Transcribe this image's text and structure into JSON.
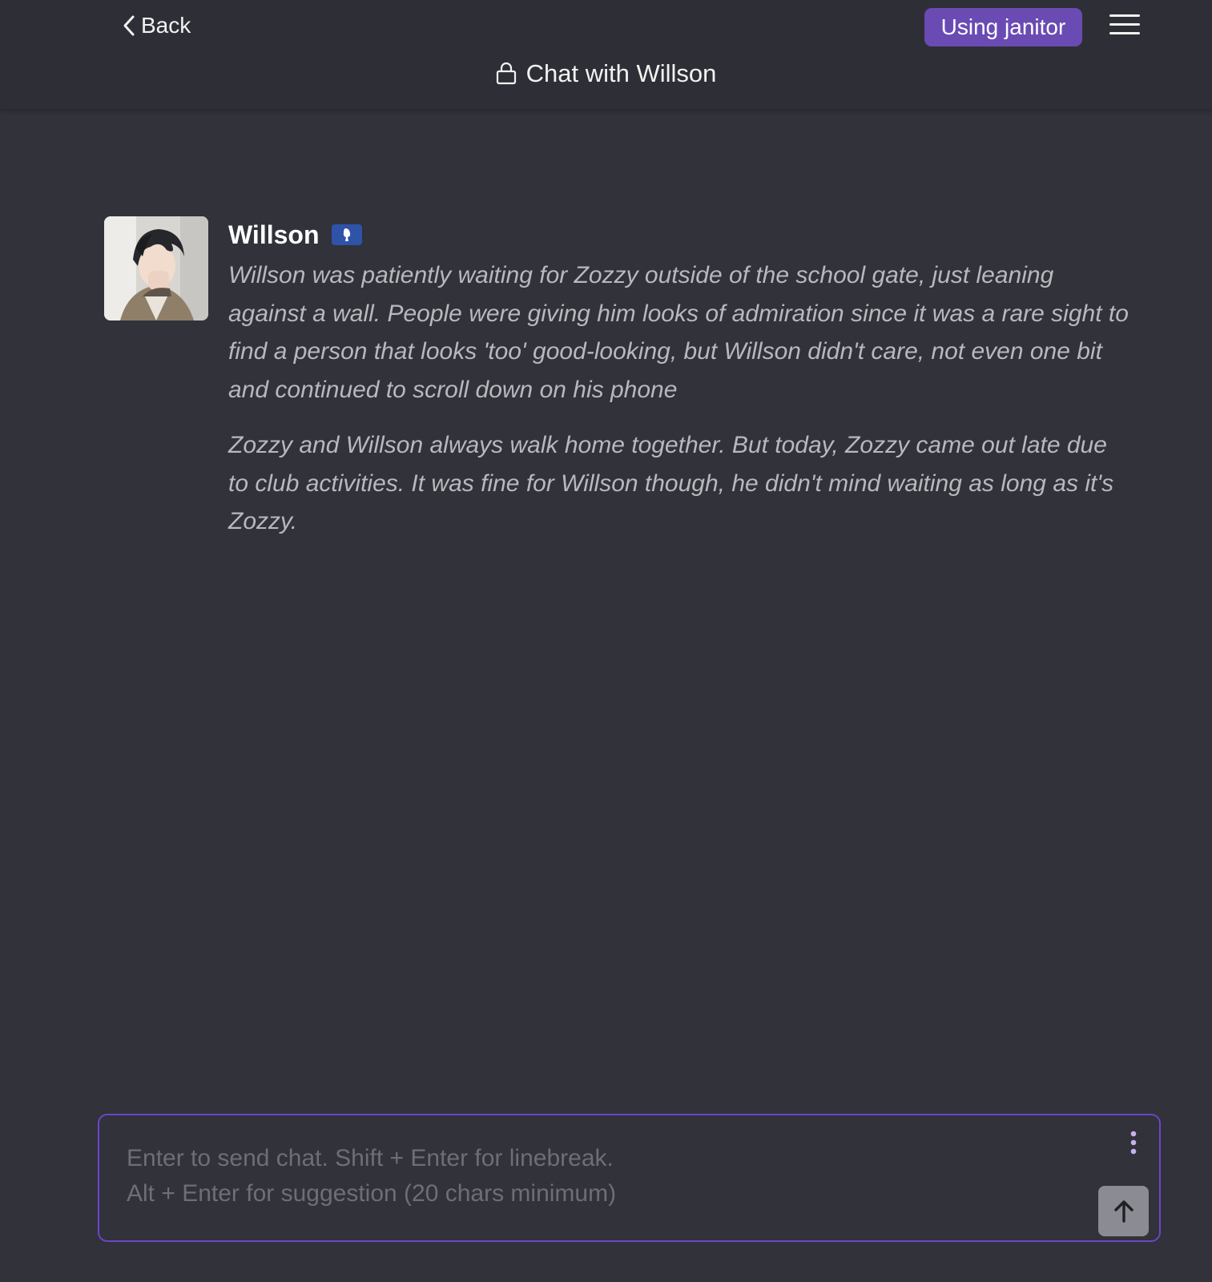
{
  "header": {
    "back_label": "Back",
    "using_label": "Using janitor",
    "title": "Chat with Willson"
  },
  "message": {
    "name": "Willson",
    "paragraphs": [
      "Willson was patiently waiting for Zozzy outside of the school gate, just leaning against a wall. People were giving him looks of admiration since it was a rare sight to find a person that looks 'too' good-looking, but Willson didn't care, not even one bit and continued to scroll down on his phone",
      "Zozzy and Willson always walk home together. But today, Zozzy came out late due to club activities. It was fine for Willson though, he didn't mind waiting as long as it's Zozzy."
    ]
  },
  "composer": {
    "placeholder": "Enter to send chat. Shift + Enter for linebreak.\nAlt + Enter for suggestion (20 chars minimum)"
  },
  "colors": {
    "background": "#31323a",
    "accent": "#6a4bb3",
    "input_border": "#6c45c8",
    "badge": "#2f53a8"
  },
  "icons": {
    "back": "chevron-left-icon",
    "menu": "hamburger-menu-icon",
    "title": "lock-icon",
    "badge": "figure-badge-icon",
    "more": "vertical-dots-icon",
    "send": "arrow-up-icon"
  }
}
